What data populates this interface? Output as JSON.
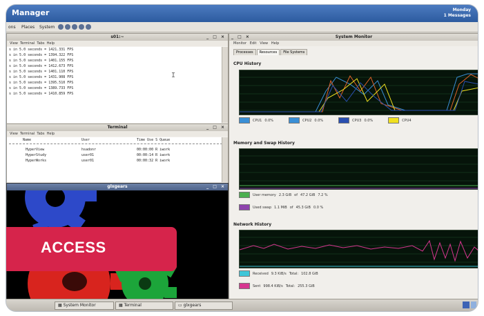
{
  "title_bar": {
    "title": "Manager",
    "right_top": "Monday",
    "right_bottom": "1 Messages"
  },
  "menubar": {
    "items": [
      "ons",
      "Places",
      "System"
    ]
  },
  "terminal1": {
    "title": "s01:~",
    "menu": [
      "View",
      "Terminal",
      "Tabs",
      "Help"
    ],
    "lines": [
      "s in 5.0 seconds = 1421.331 FPS",
      "s in 5.0 seconds = 1394.322 FPS",
      "s in 5.0 seconds = 1401.155 FPS",
      "s in 5.0 seconds = 1412.673 FPS",
      "s in 5.0 seconds = 1401.110 FPS",
      "s in 5.0 seconds = 1431.908 FPS",
      "s in 5.0 seconds = 1395.510 FPS",
      "s in 5.0 seconds = 1389.733 FPS",
      "s in 5.0 seconds = 1410.859 FPS"
    ]
  },
  "terminal2": {
    "title": "Terminal",
    "menu": [
      "View",
      "Terminal",
      "Tabs",
      "Help"
    ],
    "header": {
      "name": "Name",
      "user": "User",
      "time": "Time Use S Queue"
    },
    "rows": [
      {
        "name": "HyperView",
        "user": "hsadonr",
        "time": "00:00:00 R iwork"
      },
      {
        "name": "HyperStudy",
        "user": "user01",
        "time": "00:00:14 R iwork"
      },
      {
        "name": "HyperWorks",
        "user": "user01",
        "time": "00:00:32 R iwork"
      }
    ]
  },
  "glxgears": {
    "title": "glxgears"
  },
  "sysmon": {
    "title": "System Monitor",
    "menu": [
      "Monitor",
      "Edit",
      "View",
      "Help"
    ],
    "tabs": [
      "Processes",
      "Resources",
      "File Systems"
    ],
    "active_tab": "Resources",
    "cpu": {
      "label": "CPU History",
      "items": [
        {
          "name": "CPU1",
          "value": "0.0%",
          "color": "#3a8fd6"
        },
        {
          "name": "CPU2",
          "value": "0.0%",
          "color": "#3a8fd6"
        },
        {
          "name": "CPU3",
          "value": "0.0%",
          "color": "#2a4fb0"
        },
        {
          "name": "CPU4",
          "value": "",
          "color": "#f0e020"
        }
      ]
    },
    "memory": {
      "label": "Memory and Swap History",
      "items": [
        {
          "name": "User memory",
          "used": "2.3 GiB",
          "of": "of",
          "total": "47.2 GiB",
          "percent": "7.2 %",
          "color": "#4caf50"
        },
        {
          "name": "Used swap",
          "used": "1.1 MiB",
          "of": "of",
          "total": "45.3 GiB",
          "percent": "0.0 %",
          "color": "#8e44ad"
        }
      ]
    },
    "network": {
      "label": "Network History",
      "items": [
        {
          "name": "Received",
          "rate": "9.3 KiB/s",
          "total_label": "Total:",
          "total": "102.8 GiB",
          "color": "#3fc6d8"
        },
        {
          "name": "Sent",
          "rate": "998.4 KiB/s",
          "total_label": "Total:",
          "total": "255.3 GiB",
          "color": "#d6358f"
        }
      ]
    }
  },
  "taskbar": {
    "items": [
      "System Monitor",
      "Terminal",
      "glxgears"
    ]
  },
  "badge": {
    "label": "ACCESS",
    "color": "#d6244b"
  }
}
